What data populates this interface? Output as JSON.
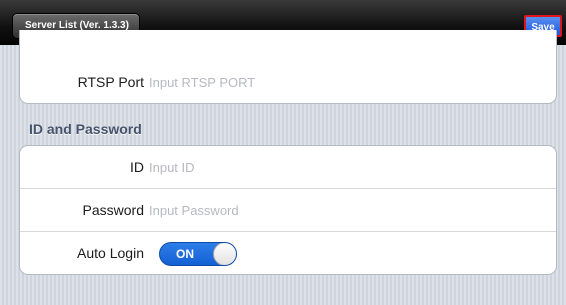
{
  "nav": {
    "back_label": "Server List (Ver. 1.3.3)",
    "save_label": "Save"
  },
  "connection": {
    "rtsp_port": {
      "label": "RTSP Port",
      "placeholder": "Input RTSP PORT",
      "value": ""
    }
  },
  "credentials": {
    "section_title": "ID and Password",
    "id": {
      "label": "ID",
      "placeholder": "Input ID",
      "value": ""
    },
    "password": {
      "label": "Password",
      "placeholder": "Input Password",
      "value": ""
    },
    "auto_login": {
      "label": "Auto Login",
      "state_text": "ON",
      "enabled": true
    }
  },
  "colors": {
    "toggle_on": "#1a6ee0",
    "save_button": "#2a66e0",
    "save_highlight": "#e0141c",
    "section_header": "#46536d"
  }
}
